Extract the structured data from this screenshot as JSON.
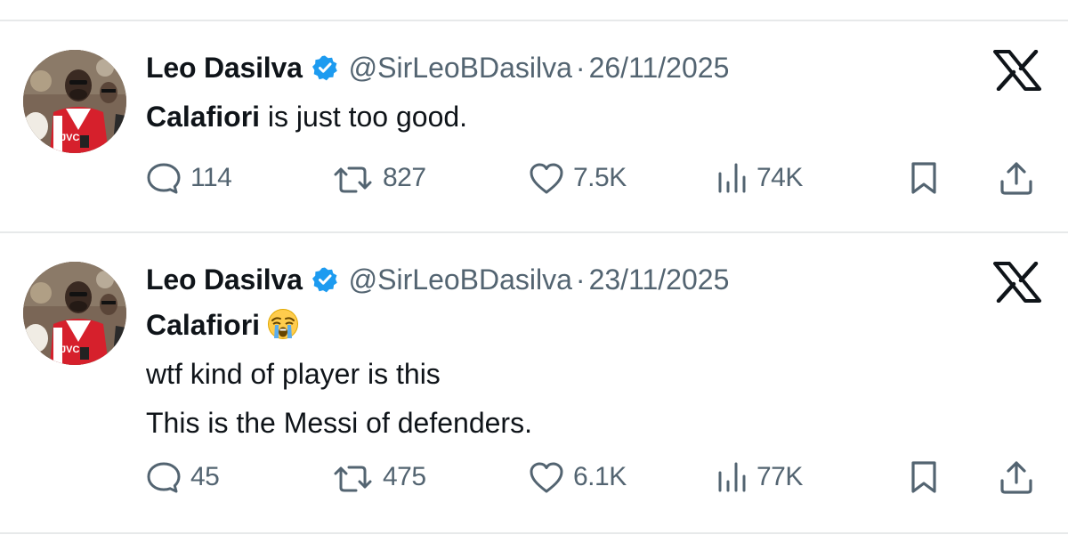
{
  "colors": {
    "verified_blue": "#1d9bf0",
    "text_primary": "#0f1419",
    "text_secondary": "#536471",
    "divider": "#e7e9ea"
  },
  "tweets": [
    {
      "name": "Leo Dasilva",
      "handle": "@SirLeoBDasilva",
      "separator": "·",
      "date": "26/11/2025",
      "text_bold": "Calafiori",
      "text_rest": " is just too good.",
      "replies": "114",
      "reposts": "827",
      "likes": "7.5K",
      "views": "74K"
    },
    {
      "name": "Leo Dasilva",
      "handle": "@SirLeoBDasilva",
      "separator": "·",
      "date": "23/11/2025",
      "text_bold": "Calafiori",
      "emoji": "loudly-crying-face",
      "line2": "wtf kind of player is this",
      "line3": "This is the Messi of defenders.",
      "replies": "45",
      "reposts": "475",
      "likes": "6.1K",
      "views": "77K"
    }
  ]
}
